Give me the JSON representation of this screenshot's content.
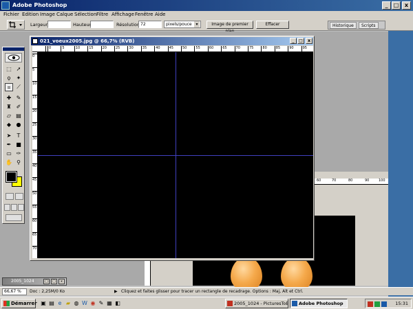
{
  "window": {
    "title": "Adobe Photoshop",
    "minimize": "_",
    "maximize": "□",
    "close": "x"
  },
  "menu": [
    "Fichier",
    "Edition",
    "Image",
    "Calque",
    "Sélection",
    "Filtre",
    "Affichage",
    "Fenêtre",
    "Aide"
  ],
  "options": {
    "tool_icon": "crop-icon",
    "width_label": "Largeur",
    "width_value": "",
    "height_label": "Hauteur",
    "height_value": "",
    "resolution_label": "Résolution",
    "resolution_value": "72",
    "unit_value": "pixels/pouce",
    "front_image_button": "Image de premier plan",
    "clear_button": "Effacer"
  },
  "palette_well": {
    "tabs": [
      "Historique",
      "Scripts"
    ]
  },
  "document": {
    "title": "021_voeux2005.jpg @ 66,7% (RVB)",
    "ruler_h": [
      "0",
      "5",
      "10",
      "15",
      "20",
      "25",
      "30",
      "35",
      "40",
      "45",
      "50",
      "55",
      "60",
      "65",
      "70",
      "75",
      "80",
      "85",
      "90",
      "95"
    ],
    "ruler_v": [
      "0",
      "5",
      "10",
      "15",
      "20",
      "25",
      "30",
      "35",
      "40",
      "45",
      "50",
      "55",
      "60",
      "65",
      "70"
    ],
    "canvas_color": "#000000",
    "guide_color": "#4040c0"
  },
  "background_doc": {
    "ruler_h": [
      "60",
      "70",
      "80",
      "90",
      "100"
    ]
  },
  "minimized_doc": {
    "title": "2005_1024"
  },
  "status": {
    "zoom": "66,67 %",
    "doc_info": "Doc : 2,25M/0 Ko",
    "hint": "Cliquez et faites glisser pour tracer un rectangle de recadrage. Options : Maj, Alt et Ctrl."
  },
  "taskbar": {
    "start": "Démarrer",
    "tasks": [
      "2005_1024 - PicturesToE...",
      "Adobe Photoshop"
    ],
    "clock": "15:31"
  }
}
